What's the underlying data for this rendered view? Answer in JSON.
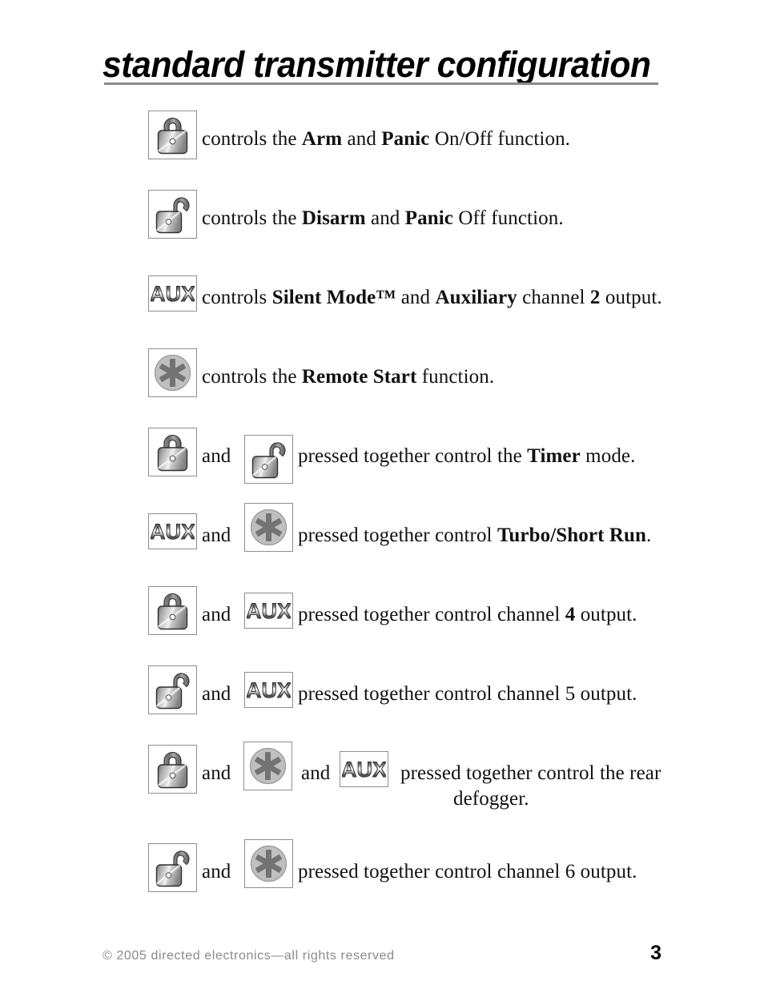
{
  "page": {
    "title": "standard transmitter configuration",
    "number": "3",
    "copyright": "© 2005 directed electronics—all rights reserved"
  },
  "icons": {
    "lock_label": "AUX",
    "aux_text": "AUX"
  },
  "rows": [
    {
      "icons": [
        "lock-closed-icon"
      ],
      "text_segments": [
        {
          "t": "controls the ",
          "b": false
        },
        {
          "t": "Arm",
          "b": true
        },
        {
          "t": " and ",
          "b": false
        },
        {
          "t": "Panic",
          "b": true
        },
        {
          "t": " On/Off function.",
          "b": false
        }
      ],
      "plain": "controls the Arm and Panic On/Off function."
    },
    {
      "icons": [
        "lock-open-icon"
      ],
      "text_segments": [
        {
          "t": "controls the ",
          "b": false
        },
        {
          "t": "Disarm",
          "b": true
        },
        {
          "t": " and ",
          "b": false
        },
        {
          "t": "Panic",
          "b": true
        },
        {
          "t": " Off function.",
          "b": false
        }
      ],
      "plain": "controls the Disarm and Panic Off function."
    },
    {
      "icons": [
        "aux-icon"
      ],
      "text_segments": [
        {
          "t": "controls ",
          "b": false
        },
        {
          "t": "Silent Mode™",
          "b": true
        },
        {
          "t": " and ",
          "b": false
        },
        {
          "t": "Auxiliary",
          "b": true
        },
        {
          "t": " channel ",
          "b": false
        },
        {
          "t": "2",
          "b": true
        },
        {
          "t": " output.",
          "b": false
        }
      ],
      "plain": "controls Silent Mode™ and Auxiliary channel 2 output."
    },
    {
      "icons": [
        "star-icon"
      ],
      "text_segments": [
        {
          "t": "controls the ",
          "b": false
        },
        {
          "t": "Remote Start",
          "b": true
        },
        {
          "t": " function.",
          "b": false
        }
      ],
      "plain": "controls the Remote Start function."
    },
    {
      "icons": [
        "lock-closed-icon",
        "lock-open-icon"
      ],
      "conjunction": "and",
      "text_segments": [
        {
          "t": "pressed together control the ",
          "b": false
        },
        {
          "t": "Timer",
          "b": true
        },
        {
          "t": " mode.",
          "b": false
        }
      ],
      "plain": "pressed together control the Timer mode."
    },
    {
      "icons": [
        "aux-icon",
        "star-icon"
      ],
      "conjunction": "and",
      "text_segments": [
        {
          "t": "pressed together control ",
          "b": false
        },
        {
          "t": "Turbo/Short Run",
          "b": true
        },
        {
          "t": ".",
          "b": false
        }
      ],
      "plain": "pressed together control Turbo/Short Run."
    },
    {
      "icons": [
        "lock-closed-icon",
        "aux-icon"
      ],
      "conjunction": "and",
      "text_segments": [
        {
          "t": "pressed together control channel ",
          "b": false
        },
        {
          "t": "4",
          "b": true
        },
        {
          "t": " output.",
          "b": false
        }
      ],
      "plain": "pressed together control channel 4 output."
    },
    {
      "icons": [
        "lock-open-icon",
        "aux-icon"
      ],
      "conjunction": "and",
      "text_segments": [
        {
          "t": "pressed together control channel 5 output.",
          "b": false
        }
      ],
      "plain": "pressed together control channel 5 output."
    },
    {
      "icons": [
        "lock-closed-icon",
        "star-icon",
        "aux-icon"
      ],
      "conjunction": "and",
      "conjunction2": "and",
      "text_segments": [
        {
          "t": "pressed together control the rear",
          "b": false
        }
      ],
      "line2": "defogger.",
      "plain": "pressed together control the rear defogger."
    },
    {
      "icons": [
        "lock-open-icon",
        "star-icon"
      ],
      "conjunction": "and",
      "text_segments": [
        {
          "t": "pressed together control channel 6 output.",
          "b": false
        }
      ],
      "plain": "pressed together control channel 6 output."
    }
  ],
  "colors": {
    "icon_border": "#8e8e8e",
    "metal_dark": "#4a4a4a",
    "metal_light": "#e6e6e6",
    "star_circle": "#bfbfbf",
    "star_glyph": "#737373",
    "rule": "#8a8a8a",
    "footer_text": "#8a8a8a"
  }
}
